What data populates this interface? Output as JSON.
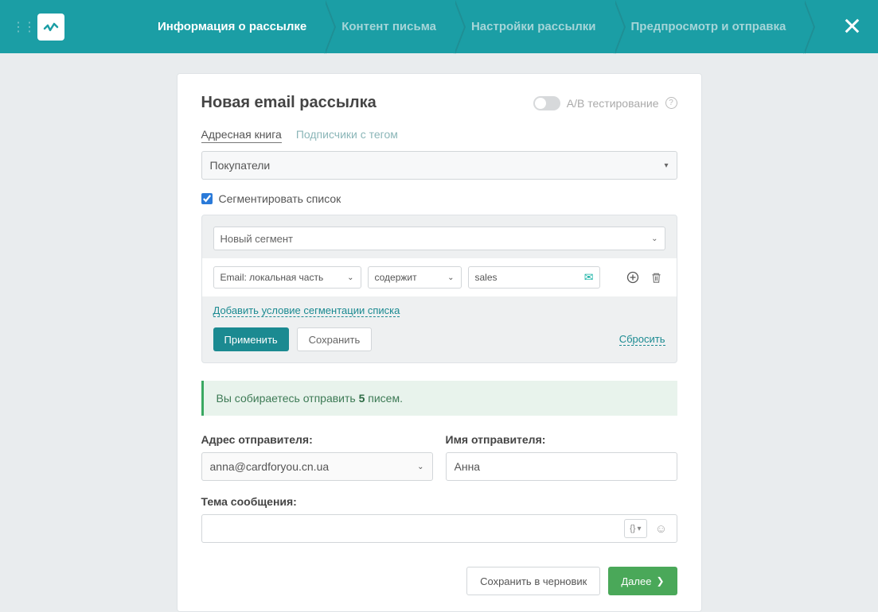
{
  "header": {
    "steps": [
      {
        "label": "Информация о рассылке",
        "active": true
      },
      {
        "label": "Контент письма",
        "active": false
      },
      {
        "label": "Настройки рассылки",
        "active": false
      },
      {
        "label": "Предпросмотр и отправка",
        "active": false
      }
    ]
  },
  "page": {
    "title": "Новая email рассылка",
    "ab_label": "A/B тестирование"
  },
  "tabs": {
    "address_book": "Адресная книга",
    "subscribers_with_tag": "Подписчики с тегом"
  },
  "address_book_select": {
    "value": "Покупатели"
  },
  "segment_checkbox": {
    "label": "Сегментировать список",
    "checked": true
  },
  "segment": {
    "select_value": "Новый сегмент",
    "rule": {
      "field": "Email: локальная часть",
      "operator": "содержит",
      "value": "sales"
    },
    "add_condition": "Добавить условие сегментации списка",
    "apply": "Применить",
    "save": "Сохранить",
    "reset": "Сбросить"
  },
  "banner": {
    "prefix": "Вы собираетесь отправить ",
    "count": "5",
    "suffix": " писем."
  },
  "sender": {
    "address_label": "Адрес отправителя:",
    "address_value": "anna@cardforyou.cn.ua",
    "name_label": "Имя отправителя:",
    "name_value": "Анна"
  },
  "subject": {
    "label": "Тема сообщения:",
    "value": "",
    "vars_label": "{}"
  },
  "footer": {
    "draft": "Сохранить в черновик",
    "next": "Далее"
  }
}
